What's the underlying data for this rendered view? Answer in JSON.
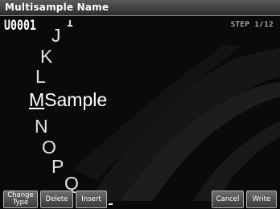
{
  "title_bar": {
    "title": "Multisample Name"
  },
  "name_field": {
    "prefix": "U0001",
    "step_label": "STEP  1/12"
  },
  "char_wheel": {
    "above": [
      "J",
      "K",
      "L"
    ],
    "current": {
      "first_char": "M",
      "rest": "Sample"
    },
    "below": [
      "N",
      "O",
      "P",
      "Q"
    ]
  },
  "function_buttons": {
    "change_type_line1": "Change",
    "change_type_line2": "Type",
    "delete": "Delete",
    "insert": "Insert",
    "cancel": "Cancel",
    "write": "Write"
  },
  "colors": {
    "title_bar": "#3a3a3a",
    "background": "#0a0a0a",
    "text": "#ffffff"
  }
}
